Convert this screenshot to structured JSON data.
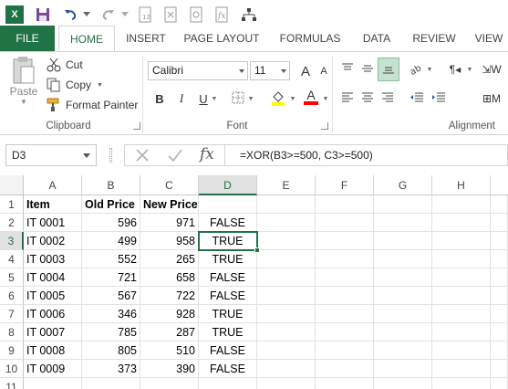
{
  "qat": {
    "app_icon": "X",
    "undo_icon": "undo-icon",
    "redo_icon": "redo-icon"
  },
  "tabs": [
    "FILE",
    "HOME",
    "INSERT",
    "PAGE LAYOUT",
    "FORMULAS",
    "DATA",
    "REVIEW",
    "VIEW"
  ],
  "ribbon": {
    "clipboard": {
      "paste": "Paste",
      "cut": "Cut",
      "copy": "Copy",
      "format_painter": "Format Painter",
      "label": "Clipboard"
    },
    "font": {
      "name": "Calibri",
      "size": "11",
      "label": "Font",
      "bold": "B",
      "italic": "I",
      "underline": "U",
      "grow": "A",
      "shrink": "A",
      "font_color": "A"
    },
    "alignment": {
      "label": "Alignment"
    }
  },
  "formula_bar": {
    "name_box": "D3",
    "fx": "fx",
    "formula": "=XOR(B3>=500, C3>=500)"
  },
  "columns": [
    "A",
    "B",
    "C",
    "D",
    "E",
    "F",
    "G",
    "H"
  ],
  "rows": [
    "1",
    "2",
    "3",
    "4",
    "5",
    "6",
    "7",
    "8",
    "9",
    "10",
    "11"
  ],
  "sheet": {
    "header": [
      "Item",
      "Old Price",
      "New Price",
      "D"
    ],
    "data": [
      [
        "IT 0001",
        "596",
        "971",
        "FALSE"
      ],
      [
        "IT 0002",
        "499",
        "958",
        "TRUE"
      ],
      [
        "IT 0003",
        "552",
        "265",
        "TRUE"
      ],
      [
        "IT 0004",
        "721",
        "658",
        "FALSE"
      ],
      [
        "IT 0005",
        "567",
        "722",
        "FALSE"
      ],
      [
        "IT 0006",
        "346",
        "928",
        "TRUE"
      ],
      [
        "IT 0007",
        "785",
        "287",
        "TRUE"
      ],
      [
        "IT 0008",
        "805",
        "510",
        "FALSE"
      ],
      [
        "IT 0009",
        "373",
        "390",
        "FALSE"
      ]
    ]
  },
  "colors": {
    "accent": "#217346",
    "file_tab": "#217346"
  }
}
